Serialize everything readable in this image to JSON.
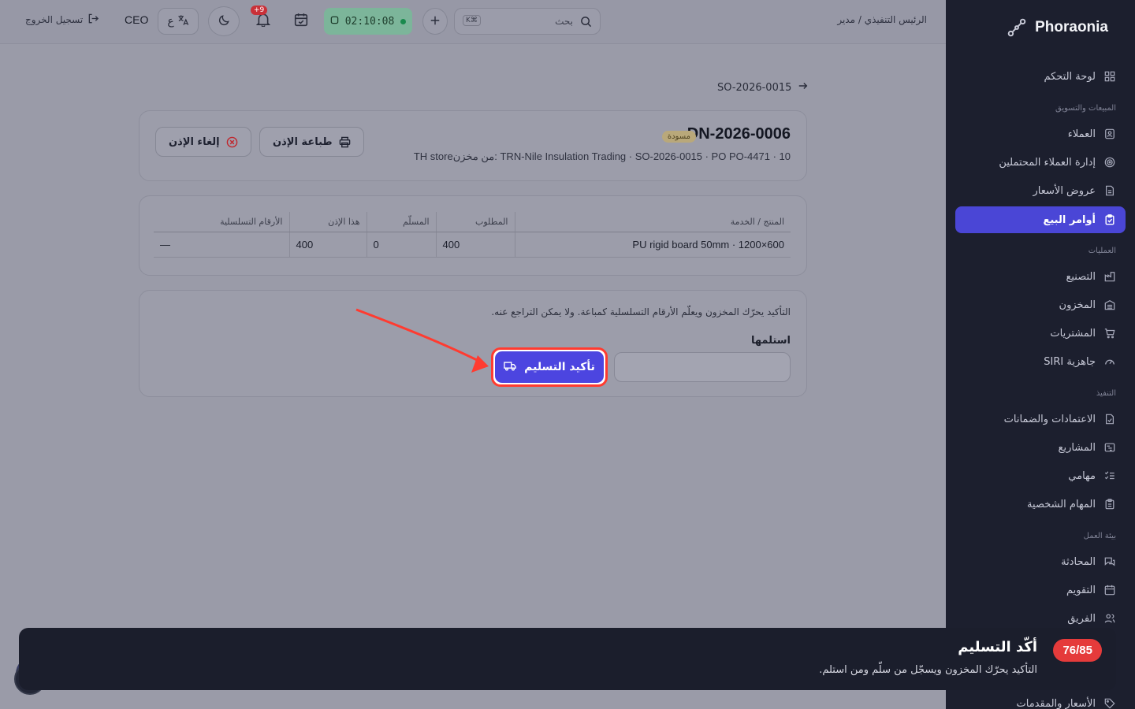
{
  "sidebar": {
    "brand": "Phoraonia",
    "items": [
      {
        "label": "لوحة التحكم",
        "icon": "grid-icon"
      },
      {
        "section": "المبيعات والتسويق"
      },
      {
        "label": "العملاء",
        "icon": "contact-icon"
      },
      {
        "label": "إدارة العملاء المحتملين",
        "icon": "target-icon"
      },
      {
        "label": "عروض الأسعار",
        "icon": "document-icon"
      },
      {
        "label": "أوامر البيع",
        "icon": "clipboard-icon",
        "active": true
      },
      {
        "section": "العمليات"
      },
      {
        "label": "التصنيع",
        "icon": "factory-icon"
      },
      {
        "label": "المخزون",
        "icon": "warehouse-icon"
      },
      {
        "label": "المشتريات",
        "icon": "cart-icon"
      },
      {
        "label": "جاهزية SIRI",
        "icon": "gauge-icon"
      },
      {
        "section": "التنفيذ"
      },
      {
        "label": "الاعتمادات والضمانات",
        "icon": "file-check-icon"
      },
      {
        "label": "المشاريع",
        "icon": "gantt-icon"
      },
      {
        "label": "مهامي",
        "icon": "checklist-icon"
      },
      {
        "label": "المهام الشخصية",
        "icon": "clipboard-list-icon"
      },
      {
        "section": "بيئة العمل"
      },
      {
        "label": "المحادثة",
        "icon": "chat-icon"
      },
      {
        "label": "التقويم",
        "icon": "calendar-icon"
      },
      {
        "label": "الفريق",
        "icon": "users-icon"
      },
      {
        "label": "الأسعار والمقدمات",
        "icon": "tag-icon"
      }
    ]
  },
  "topbar": {
    "role_text": "الرئيس التنفيذي / مدير",
    "search_placeholder": "بحث",
    "search_kbd": "K⌘",
    "timer": "02:10:08",
    "notif_count": "+9",
    "lang_label": "ع",
    "user": "CEO",
    "logout": "تسجيل الخروج"
  },
  "breadcrumb": {
    "label": "SO-2026-0015"
  },
  "document": {
    "number": "DN-2026-0006",
    "status": "مسودة",
    "subtitle": "TRN-Nile Insulation Trading · SO-2026-0015 · PO PO-4471 · 10 :من مخزنTH store",
    "print_label": "طباعة الإذن",
    "cancel_label": "إلغاء الإذن"
  },
  "lines": {
    "headers": [
      "المنتج / الخدمة",
      "المطلوب",
      "المسلّم",
      "هذا الإذن",
      "الأرقام التسلسلية"
    ],
    "rows": [
      [
        "PU rigid board 50mm · 1200×600",
        "400",
        "0",
        "400",
        "—"
      ]
    ]
  },
  "confirm": {
    "note": "التأكيد يحرّك المخزون ويعلّم الأرقام التسلسلية كمباعة. ولا يمكن التراجع عنه.",
    "received_label": "استلمها",
    "received_value": "",
    "button_label": "تأكيد التسليم"
  },
  "tour": {
    "progress": "76/85",
    "title": "أكّد التسليم",
    "description": "التأكيد يحرّك المخزون ويسجّل من سلّم ومن استلم."
  },
  "colors": {
    "sidebar_bg": "#1c1f2e",
    "accent": "#4c45e0",
    "highlight": "#ff3b30",
    "tour_badge": "#e53b3b"
  }
}
